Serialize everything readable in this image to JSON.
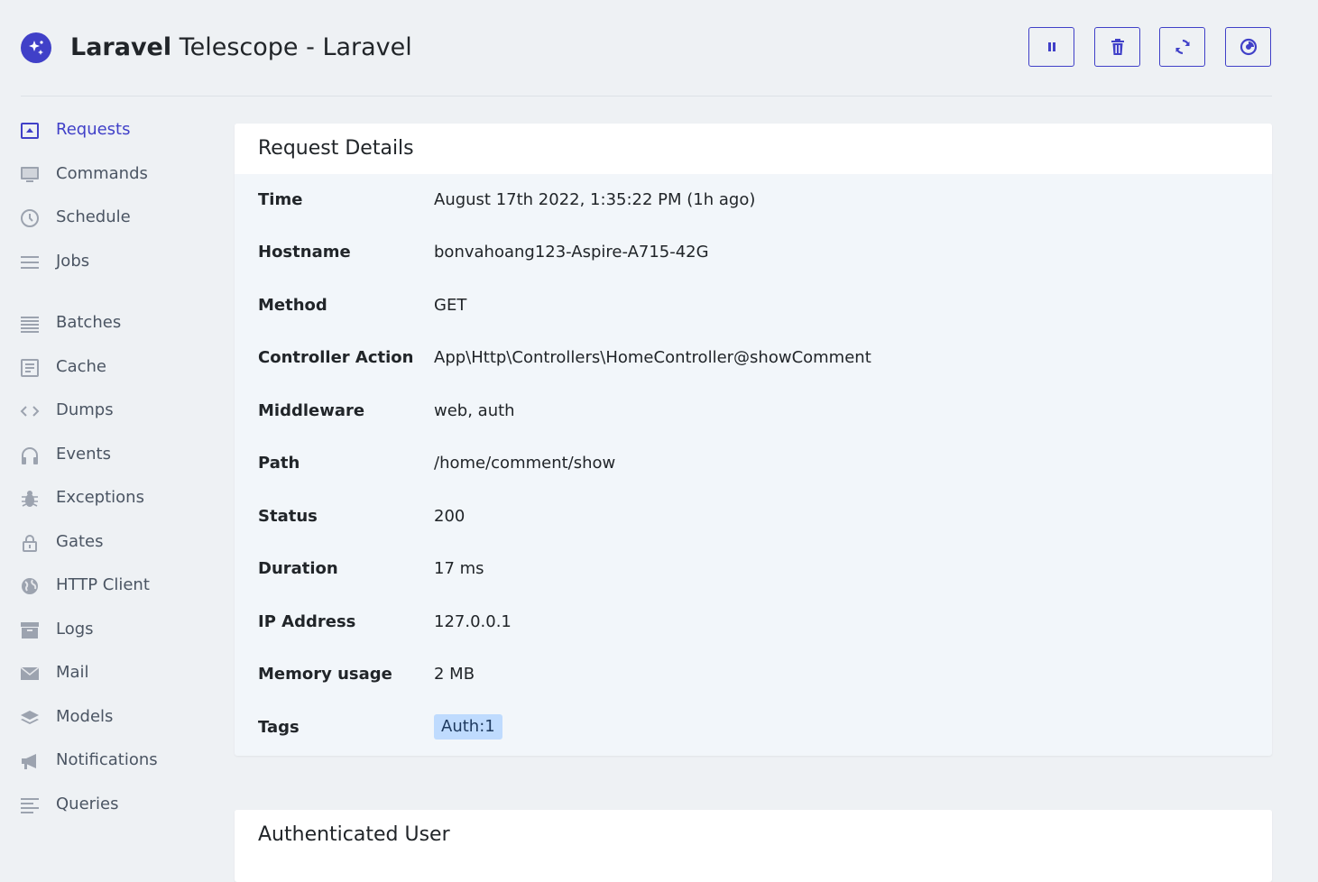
{
  "header": {
    "brand_bold": "Laravel",
    "brand_rest": " Telescope - Laravel",
    "buttons": [
      {
        "icon": "pause-icon"
      },
      {
        "icon": "trash-icon"
      },
      {
        "icon": "refresh-icon"
      },
      {
        "icon": "theme-icon"
      }
    ],
    "accent_color": "#4040c8"
  },
  "sidebar": {
    "items": [
      {
        "label": "Requests",
        "icon": "requests-icon",
        "active": true
      },
      {
        "label": "Commands",
        "icon": "monitor-icon"
      },
      {
        "label": "Schedule",
        "icon": "clock-icon"
      },
      {
        "label": "Jobs",
        "icon": "jobs-icon"
      },
      {
        "label": "Batches",
        "icon": "batches-icon"
      },
      {
        "label": "Cache",
        "icon": "cache-icon"
      },
      {
        "label": "Dumps",
        "icon": "code-icon"
      },
      {
        "label": "Events",
        "icon": "headphones-icon"
      },
      {
        "label": "Exceptions",
        "icon": "bug-icon"
      },
      {
        "label": "Gates",
        "icon": "lock-icon"
      },
      {
        "label": "HTTP Client",
        "icon": "globe-icon"
      },
      {
        "label": "Logs",
        "icon": "archive-icon"
      },
      {
        "label": "Mail",
        "icon": "mail-icon"
      },
      {
        "label": "Models",
        "icon": "layers-icon"
      },
      {
        "label": "Notifications",
        "icon": "megaphone-icon"
      },
      {
        "label": "Queries",
        "icon": "queries-icon"
      }
    ]
  },
  "request_details": {
    "title": "Request Details",
    "rows": [
      {
        "key": "Time",
        "value": "August 17th 2022, 1:35:22 PM (1h ago)"
      },
      {
        "key": "Hostname",
        "value": "bonvahoang123-Aspire-A715-42G"
      },
      {
        "key": "Method",
        "value": "GET"
      },
      {
        "key": "Controller Action",
        "value": "App\\Http\\Controllers\\HomeController@showComment"
      },
      {
        "key": "Middleware",
        "value": "web, auth"
      },
      {
        "key": "Path",
        "value": "/home/comment/show"
      },
      {
        "key": "Status",
        "value": "200"
      },
      {
        "key": "Duration",
        "value": "17 ms"
      },
      {
        "key": "IP Address",
        "value": "127.0.0.1"
      },
      {
        "key": "Memory usage",
        "value": "2 MB"
      }
    ],
    "tags_key": "Tags",
    "tags": [
      "Auth:1"
    ]
  },
  "authenticated_user": {
    "title": "Authenticated User"
  }
}
